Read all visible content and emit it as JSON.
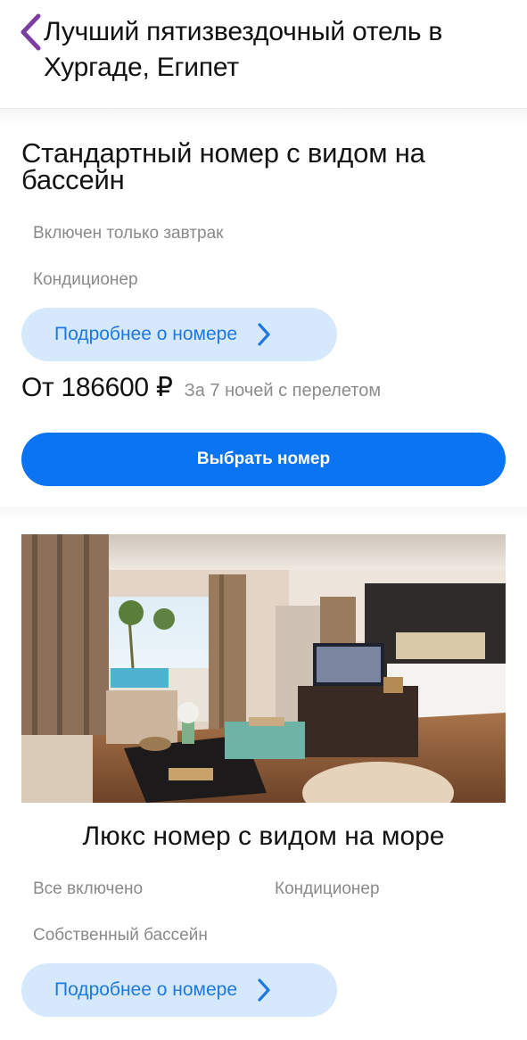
{
  "header": {
    "back_icon": "chevron-left-icon",
    "title": "Лучший пятизвездочный отель в Хургаде, Египет",
    "accent": "#7b3fa0"
  },
  "rooms": [
    {
      "title": "Стандартный номер с видом на бассейн",
      "features": [
        "Включен только завтрак",
        "Кондиционер"
      ],
      "details_label": "Подробнее о номере",
      "details_icon": "chevron-right-icon",
      "price": "От 186600 ₽",
      "price_note": "За 7 ночей с перелетом",
      "select_label": "Выбрать номер"
    },
    {
      "photo": "hotel-room-photo",
      "title": "Люкс номер с видом на море",
      "features": [
        "Все включено",
        "Кондиционер",
        "Собственный бассейн"
      ],
      "details_label": "Подробнее о номере",
      "details_icon": "chevron-right-icon"
    }
  ],
  "colors": {
    "primary": "#0b74f2",
    "secondary_bg": "#d6e8fb",
    "secondary_text": "#1e78de",
    "muted_text": "#8a8a8a"
  }
}
